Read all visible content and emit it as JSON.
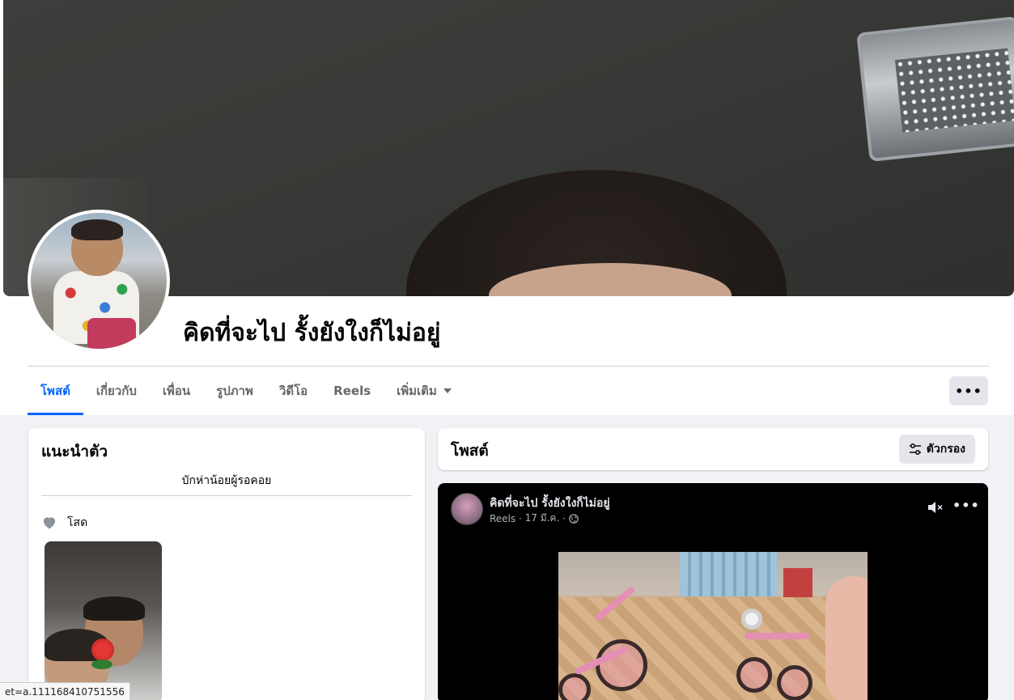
{
  "profile": {
    "name": "คิดที่จะไป รั้งยังใงก็ไม่อยู่"
  },
  "tabs": [
    {
      "label": "โพสต์",
      "active": true
    },
    {
      "label": "เกี่ยวกับ",
      "active": false
    },
    {
      "label": "เพื่อน",
      "active": false
    },
    {
      "label": "รูปภาพ",
      "active": false
    },
    {
      "label": "วิดีโอ",
      "active": false
    },
    {
      "label": "Reels",
      "active": false
    },
    {
      "label": "เพิ่มเติม",
      "active": false
    }
  ],
  "more_button": {
    "label": "•••"
  },
  "intro": {
    "title": "แนะนำตัว",
    "bio": "บักห่าน้อยผู้รอคอย",
    "relationship": "โสด"
  },
  "posts": {
    "title": "โพสต์",
    "filter_label": "ตัวกรอง"
  },
  "post": {
    "author": "คิดที่จะไป รั้งยังใงก็ไม่อยู่",
    "type": "Reels",
    "date": "17 มี.ค.",
    "more_label": "•••"
  },
  "status_bar": {
    "text": "et=a.111168410751556"
  },
  "colors": {
    "accent": "#0866ff",
    "page_bg": "#f0f2f5",
    "secondary_button": "#e4e6eb"
  }
}
